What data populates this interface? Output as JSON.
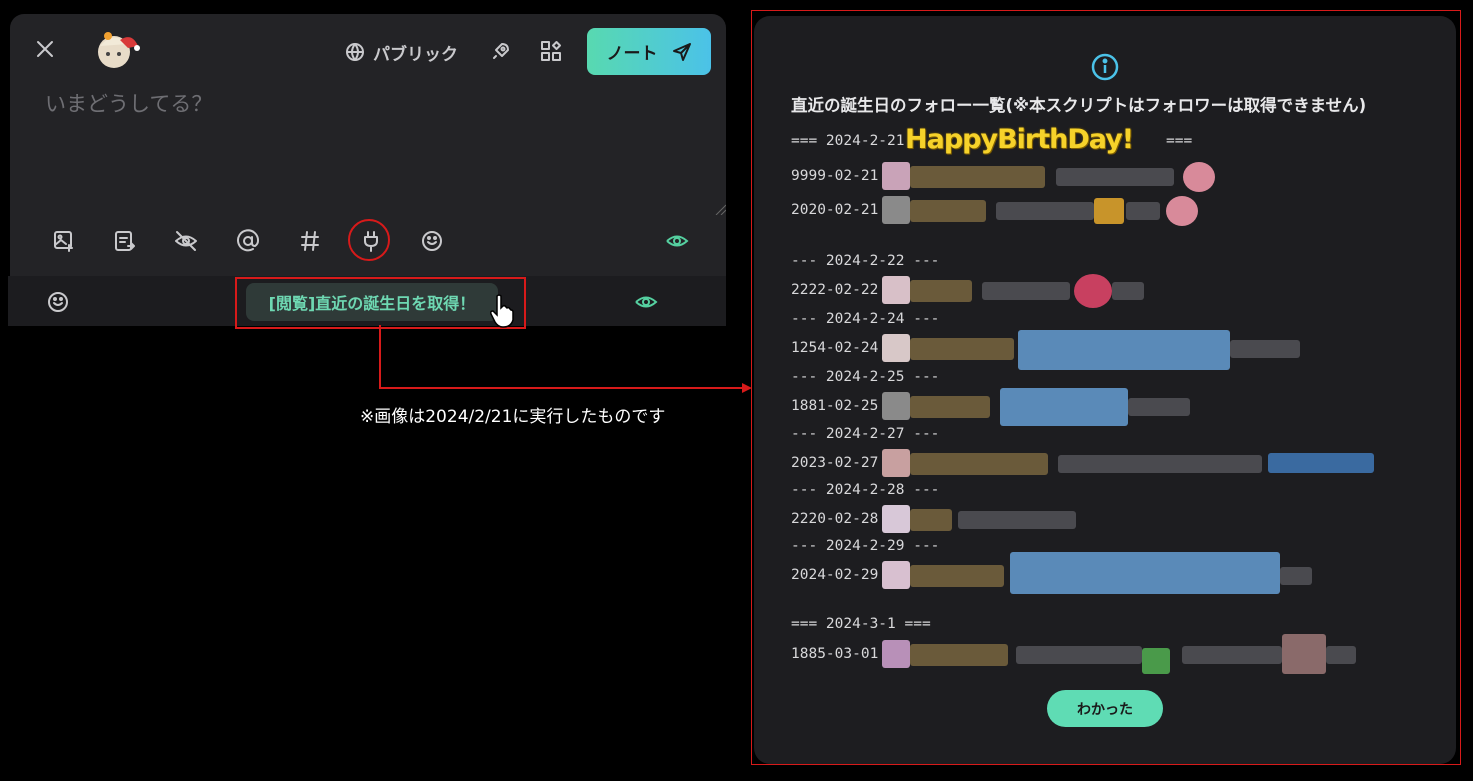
{
  "composer": {
    "visibility_label": "パブリック",
    "post_label": "ノート",
    "placeholder": "いまどうしてる？",
    "tooltip": "[閲覧]直近の誕生日を取得！"
  },
  "note": "※画像は2024/2/21に実行したものです",
  "dialog": {
    "title": "直近の誕生日のフォロー一覧(※本スクリプトはフォロワーは取得できません)",
    "headers": [
      "=== 2024-2-21",
      "--- 2024-2-22 ---",
      "--- 2024-2-24 ---",
      "--- 2024-2-25 ---",
      "--- 2024-2-27 ---",
      "--- 2024-2-28 ---",
      "--- 2024-2-29 ---",
      "=== 2024-3-1 ==="
    ],
    "header_suffix_1": "===",
    "happy_birthday": "HappyBirthDay!",
    "dates": [
      "9999-02-21",
      "2020-02-21",
      "2222-02-22",
      "1254-02-24",
      "1881-02-25",
      "2023-02-27",
      "2220-02-28",
      "2024-02-29",
      "1885-03-01"
    ],
    "ok_label": "わかった"
  },
  "colors": {
    "accent": "#5fdcb4",
    "annotation": "#d71a1a",
    "highlight": "#f6d22a"
  }
}
